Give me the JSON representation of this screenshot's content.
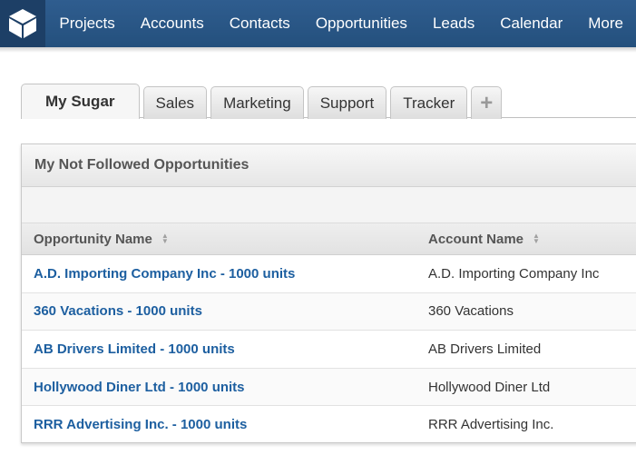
{
  "nav": {
    "items": [
      "Projects",
      "Accounts",
      "Contacts",
      "Opportunities",
      "Leads",
      "Calendar",
      "More"
    ]
  },
  "tabs": [
    "My Sugar",
    "Sales",
    "Marketing",
    "Support",
    "Tracker"
  ],
  "tab_add_label": "+",
  "dashlet": {
    "title": "My Not Followed Opportunities",
    "columns": [
      "Opportunity Name",
      "Account Name"
    ],
    "rows": [
      {
        "opportunity": "A.D. Importing Company Inc - 1000 units",
        "account": "A.D. Importing Company Inc"
      },
      {
        "opportunity": "360 Vacations - 1000 units",
        "account": "360 Vacations"
      },
      {
        "opportunity": "AB Drivers Limited - 1000 units",
        "account": "AB Drivers Limited"
      },
      {
        "opportunity": "Hollywood Diner Ltd - 1000 units",
        "account": "Hollywood Diner Ltd"
      },
      {
        "opportunity": "RRR Advertising Inc. - 1000 units",
        "account": "RRR Advertising Inc."
      }
    ]
  },
  "icons": {
    "logo": "cube-logo-icon",
    "sort": "sort-icon"
  },
  "colors": {
    "nav_bg": "#2f5d8f",
    "link": "#1d5fa0"
  }
}
